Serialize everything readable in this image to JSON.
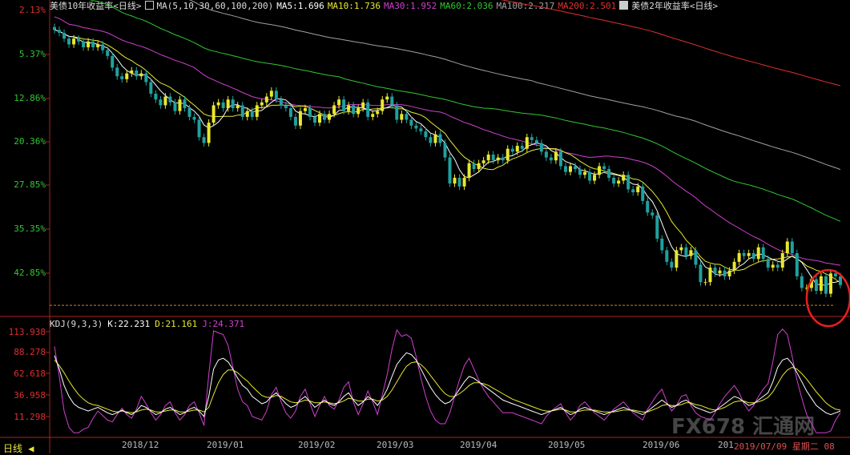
{
  "legend": {
    "main_title": "美债10年收益率<日线>",
    "ma_items": [
      {
        "label": "MA(5,10,30,60,100,200)",
        "color": "#dddddd"
      },
      {
        "label": "MA5:1.696",
        "color": "#ffffff"
      },
      {
        "label": "MA10:1.736",
        "color": "#e8e830"
      },
      {
        "label": "MA30:1.952",
        "color": "#d040d0"
      },
      {
        "label": "MA60:2.036",
        "color": "#30c830"
      },
      {
        "label": "MA100:2.217",
        "color": "#a0a0a0"
      },
      {
        "label": "MA200:2.501",
        "color": "#e03030"
      }
    ],
    "compare_title": "美债2年收益率<日线>"
  },
  "kdj_legend": [
    {
      "label": "KDJ(9,3,3)",
      "color": "#dddddd"
    },
    {
      "label": "K:22.231",
      "color": "#ffffff"
    },
    {
      "label": "D:21.161",
      "color": "#e8e830"
    },
    {
      "label": "J:24.371",
      "color": "#d040d0"
    }
  ],
  "period_label": "日线",
  "date_info": "2019/07/09 星期二 08",
  "watermark": "FX678 汇通网",
  "colors": {
    "up": "#e8e830",
    "down": "#20a0a0",
    "grid_red": "#b02020"
  },
  "chart_data": [
    {
      "type": "candlestick",
      "title": "美债10年收益率<日线>",
      "y_axis": "percent change labels (inverted)",
      "y_tick_labels": [
        "2.13%",
        "5.37%",
        "12.86%",
        "20.36%",
        "27.85%",
        "35.35%",
        "42.85%"
      ],
      "x_tick_labels": [
        "2018/12",
        "2019/01",
        "2019/02",
        "2019/03",
        "2019/04",
        "2019/05",
        "2019/06",
        "201"
      ],
      "ylim": [
        1.6,
        2.65
      ],
      "x": [
        "2018-11-15",
        "2018-11-16",
        "2018-11-19",
        "2018-11-20",
        "2018-11-21",
        "2018-11-23",
        "2018-11-26",
        "2018-11-27",
        "2018-11-28",
        "2018-11-29",
        "2018-11-30",
        "2018-12-03",
        "2018-12-04",
        "2018-12-06",
        "2018-12-07",
        "2018-12-10",
        "2018-12-11",
        "2018-12-12",
        "2018-12-13",
        "2018-12-14",
        "2018-12-17",
        "2018-12-18",
        "2018-12-19",
        "2018-12-20",
        "2018-12-21",
        "2018-12-24",
        "2018-12-26",
        "2018-12-27",
        "2018-12-28",
        "2018-12-31",
        "2019-01-02",
        "2019-01-03",
        "2019-01-04",
        "2019-01-07",
        "2019-01-08",
        "2019-01-09",
        "2019-01-10",
        "2019-01-11",
        "2019-01-14",
        "2019-01-15",
        "2019-01-16",
        "2019-01-17",
        "2019-01-18",
        "2019-01-22",
        "2019-01-23",
        "2019-01-24",
        "2019-01-25",
        "2019-01-28",
        "2019-01-29",
        "2019-01-30",
        "2019-01-31",
        "2019-02-01",
        "2019-02-04",
        "2019-02-05",
        "2019-02-06",
        "2019-02-07",
        "2019-02-08",
        "2019-02-11",
        "2019-02-12",
        "2019-02-13",
        "2019-02-14",
        "2019-02-15",
        "2019-02-19",
        "2019-02-20",
        "2019-02-21",
        "2019-02-22",
        "2019-02-25",
        "2019-02-26",
        "2019-02-27",
        "2019-02-28",
        "2019-03-01",
        "2019-03-04",
        "2019-03-05",
        "2019-03-06",
        "2019-03-07",
        "2019-03-08",
        "2019-03-11",
        "2019-03-12",
        "2019-03-13",
        "2019-03-14",
        "2019-03-15",
        "2019-03-18",
        "2019-03-19",
        "2019-03-20",
        "2019-03-21",
        "2019-03-22",
        "2019-03-25",
        "2019-03-26",
        "2019-03-27",
        "2019-03-28",
        "2019-03-29",
        "2019-04-01",
        "2019-04-02",
        "2019-04-03",
        "2019-04-04",
        "2019-04-05",
        "2019-04-08",
        "2019-04-09",
        "2019-04-10",
        "2019-04-11",
        "2019-04-12",
        "2019-04-15",
        "2019-04-16",
        "2019-04-17",
        "2019-04-18",
        "2019-04-22",
        "2019-04-23",
        "2019-04-24",
        "2019-04-25",
        "2019-04-26",
        "2019-04-29",
        "2019-04-30",
        "2019-05-01",
        "2019-05-02",
        "2019-05-03",
        "2019-05-06",
        "2019-05-07",
        "2019-05-08",
        "2019-05-09",
        "2019-05-10",
        "2019-05-13",
        "2019-05-14",
        "2019-05-15",
        "2019-05-16",
        "2019-05-17",
        "2019-05-20",
        "2019-05-21",
        "2019-05-22",
        "2019-05-23",
        "2019-05-24",
        "2019-05-28",
        "2019-05-29",
        "2019-05-30",
        "2019-05-31",
        "2019-06-03",
        "2019-06-04",
        "2019-06-05",
        "2019-06-06",
        "2019-06-07",
        "2019-06-10",
        "2019-06-11",
        "2019-06-12",
        "2019-06-13",
        "2019-06-14",
        "2019-06-17",
        "2019-06-18",
        "2019-06-19",
        "2019-06-20",
        "2019-06-21",
        "2019-06-24",
        "2019-06-25",
        "2019-06-26",
        "2019-06-27",
        "2019-06-28",
        "2019-07-01",
        "2019-07-02",
        "2019-07-03",
        "2019-07-05",
        "2019-07-08",
        "2019-07-09"
      ],
      "close": [
        2.58,
        2.57,
        2.55,
        2.53,
        2.55,
        2.54,
        2.52,
        2.54,
        2.52,
        2.53,
        2.51,
        2.49,
        2.45,
        2.42,
        2.41,
        2.43,
        2.44,
        2.42,
        2.43,
        2.4,
        2.36,
        2.34,
        2.32,
        2.35,
        2.33,
        2.3,
        2.34,
        2.31,
        2.28,
        2.27,
        2.21,
        2.19,
        2.26,
        2.32,
        2.33,
        2.31,
        2.34,
        2.31,
        2.32,
        2.28,
        2.3,
        2.28,
        2.32,
        2.33,
        2.35,
        2.37,
        2.34,
        2.32,
        2.31,
        2.28,
        2.25,
        2.3,
        2.31,
        2.28,
        2.26,
        2.29,
        2.27,
        2.29,
        2.32,
        2.34,
        2.3,
        2.32,
        2.29,
        2.31,
        2.33,
        2.28,
        2.29,
        2.3,
        2.34,
        2.35,
        2.32,
        2.27,
        2.29,
        2.27,
        2.25,
        2.24,
        2.23,
        2.21,
        2.19,
        2.22,
        2.19,
        2.14,
        2.05,
        2.07,
        2.04,
        2.07,
        2.12,
        2.1,
        2.12,
        2.13,
        2.15,
        2.13,
        2.14,
        2.13,
        2.17,
        2.16,
        2.18,
        2.17,
        2.21,
        2.2,
        2.19,
        2.16,
        2.14,
        2.13,
        2.16,
        2.11,
        2.09,
        2.11,
        2.1,
        2.08,
        2.09,
        2.06,
        2.08,
        2.11,
        2.1,
        2.07,
        2.05,
        2.06,
        2.08,
        2.03,
        2.02,
        2.04,
        1.99,
        1.95,
        1.94,
        1.86,
        1.82,
        1.78,
        1.76,
        1.82,
        1.83,
        1.8,
        1.82,
        1.77,
        1.71,
        1.71,
        1.76,
        1.74,
        1.75,
        1.73,
        1.75,
        1.78,
        1.81,
        1.8,
        1.81,
        1.79,
        1.83,
        1.79,
        1.76,
        1.77,
        1.76,
        1.81,
        1.85,
        1.81,
        1.73,
        1.69,
        1.69,
        1.72,
        1.68,
        1.73,
        1.67,
        1.74,
        1.73,
        1.7
      ]
    },
    {
      "type": "line",
      "title": "KDJ(9,3,3)",
      "y_tick_labels": [
        "113.938",
        "88.278",
        "62.618",
        "36.958",
        "11.298"
      ],
      "ylim": [
        -5,
        120
      ],
      "series": [
        {
          "name": "K",
          "color": "#ffffff"
        },
        {
          "name": "D",
          "color": "#e8e830"
        },
        {
          "name": "J",
          "color": "#d040d0"
        }
      ],
      "k": [
        85,
        70,
        52,
        40,
        32,
        28,
        26,
        24,
        26,
        28,
        25,
        22,
        20,
        22,
        25,
        22,
        20,
        24,
        30,
        28,
        24,
        20,
        22,
        26,
        28,
        24,
        20,
        22,
        26,
        28,
        24,
        18,
        40,
        70,
        80,
        82,
        78,
        70,
        60,
        52,
        48,
        40,
        36,
        32,
        34,
        40,
        44,
        38,
        32,
        28,
        30,
        36,
        40,
        34,
        28,
        32,
        36,
        32,
        30,
        34,
        40,
        44,
        36,
        30,
        34,
        40,
        36,
        30,
        38,
        48,
        62,
        75,
        82,
        88,
        86,
        80,
        70,
        60,
        50,
        42,
        36,
        32,
        34,
        40,
        48,
        56,
        62,
        60,
        56,
        52,
        48,
        44,
        40,
        36,
        34,
        32,
        30,
        28,
        26,
        24,
        22,
        20,
        22,
        24,
        26,
        28,
        24,
        20,
        22,
        26,
        28,
        26,
        24,
        22,
        20,
        22,
        24,
        26,
        28,
        26,
        24,
        22,
        20,
        24,
        28,
        32,
        36,
        32,
        28,
        30,
        34,
        36,
        32,
        28,
        26,
        24,
        22,
        24,
        28,
        32,
        36,
        40,
        38,
        34,
        30,
        32,
        36,
        40,
        44,
        56,
        72,
        80,
        82,
        76,
        66,
        56,
        46,
        38,
        30,
        26,
        22,
        20,
        22,
        24
      ],
      "d": [
        80,
        74,
        66,
        57,
        49,
        42,
        37,
        33,
        31,
        30,
        28,
        26,
        24,
        23,
        24,
        23,
        22,
        23,
        25,
        26,
        25,
        23,
        23,
        24,
        25,
        25,
        23,
        23,
        24,
        25,
        25,
        23,
        28,
        42,
        55,
        64,
        69,
        69,
        66,
        61,
        57,
        51,
        46,
        41,
        39,
        39,
        41,
        40,
        37,
        34,
        33,
        34,
        36,
        35,
        33,
        33,
        34,
        33,
        32,
        33,
        35,
        38,
        37,
        35,
        35,
        37,
        37,
        35,
        36,
        40,
        47,
        56,
        65,
        73,
        77,
        78,
        75,
        70,
        63,
        56,
        49,
        43,
        40,
        40,
        43,
        47,
        52,
        55,
        55,
        54,
        52,
        49,
        46,
        43,
        40,
        37,
        35,
        33,
        31,
        29,
        27,
        25,
        24,
        24,
        25,
        26,
        25,
        23,
        23,
        24,
        25,
        25,
        25,
        24,
        23,
        23,
        23,
        24,
        25,
        25,
        25,
        24,
        23,
        23,
        25,
        27,
        30,
        31,
        30,
        30,
        31,
        33,
        33,
        31,
        30,
        28,
        26,
        25,
        26,
        28,
        31,
        34,
        35,
        35,
        33,
        33,
        34,
        36,
        39,
        45,
        54,
        63,
        69,
        72,
        70,
        65,
        59,
        52,
        45,
        39,
        33,
        29,
        26,
        25
      ],
      "j": [
        95,
        62,
        24,
        6,
        0,
        0,
        4,
        6,
        16,
        24,
        19,
        14,
        12,
        20,
        27,
        20,
        16,
        26,
        40,
        32,
        22,
        14,
        20,
        30,
        34,
        22,
        14,
        20,
        30,
        34,
        22,
        8,
        64,
        112,
        110,
        108,
        96,
        72,
        48,
        34,
        30,
        18,
        16,
        14,
        24,
        42,
        50,
        34,
        22,
        16,
        24,
        40,
        48,
        32,
        18,
        30,
        40,
        30,
        26,
        36,
        50,
        56,
        34,
        20,
        32,
        46,
        34,
        20,
        42,
        64,
        92,
        113,
        106,
        108,
        104,
        84,
        60,
        40,
        24,
        14,
        10,
        10,
        22,
        40,
        58,
        74,
        82,
        70,
        58,
        48,
        40,
        34,
        28,
        22,
        22,
        22,
        20,
        18,
        16,
        14,
        12,
        10,
        18,
        24,
        28,
        32,
        22,
        14,
        20,
        30,
        34,
        28,
        22,
        18,
        14,
        20,
        26,
        30,
        34,
        28,
        22,
        18,
        14,
        26,
        34,
        42,
        48,
        34,
        24,
        30,
        40,
        42,
        30,
        22,
        18,
        16,
        14,
        22,
        32,
        40,
        46,
        52,
        44,
        32,
        24,
        30,
        40,
        48,
        54,
        78,
        108,
        114,
        108,
        84,
        58,
        38,
        20,
        10,
        0,
        0,
        0,
        2,
        14,
        22
      ]
    }
  ]
}
